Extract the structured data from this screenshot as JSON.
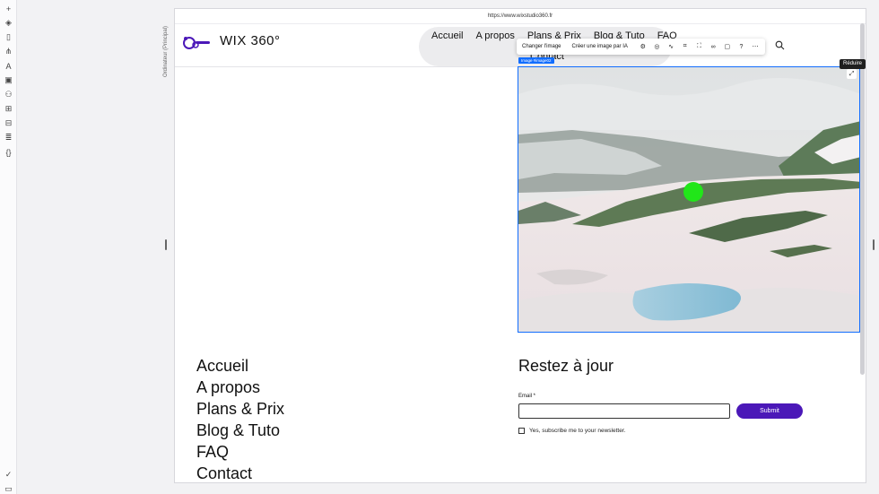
{
  "editor": {
    "device_label": "Ordinateur (Principal)",
    "tooltip_reduce": "Réduire",
    "selected_tag": "Image #image02",
    "toolbar": {
      "change_image": "Changer l'image",
      "ai_image": "Créer une image par IA",
      "icons": [
        "settings-icon",
        "animation-icon",
        "link-style-icon",
        "crop-icon",
        "focal-point-icon",
        "link-icon",
        "comment-icon",
        "help-icon",
        "more-icon"
      ]
    },
    "rail_icons": [
      "plus-icon",
      "layers-icon",
      "pages-icon",
      "sitemap-icon",
      "text-icon",
      "media-icon",
      "components-icon",
      "apps-icon",
      "business-icon",
      "cms-icon",
      "code-icon",
      "check-icon",
      "chat-icon"
    ]
  },
  "browser": {
    "url": "https://www.wixstudio360.fr"
  },
  "site": {
    "logo_text": "WIX 360°",
    "nav": [
      "Accueil",
      "A propos",
      "Plans & Prix",
      "Blog & Tuto",
      "FAQ"
    ],
    "nav_overflow": "Contact",
    "footer_menu": [
      "Accueil",
      "A propos",
      "Plans & Prix",
      "Blog & Tuto",
      "FAQ",
      "Contact"
    ],
    "newsletter": {
      "title": "Restez à jour",
      "email_label": "Email *",
      "email_value": "",
      "submit_label": "Submit",
      "consent_label": "Yes, subscribe me to your newsletter."
    }
  },
  "colors": {
    "accent": "#116dff",
    "brand": "#4b18b8",
    "marker": "#21e619"
  }
}
